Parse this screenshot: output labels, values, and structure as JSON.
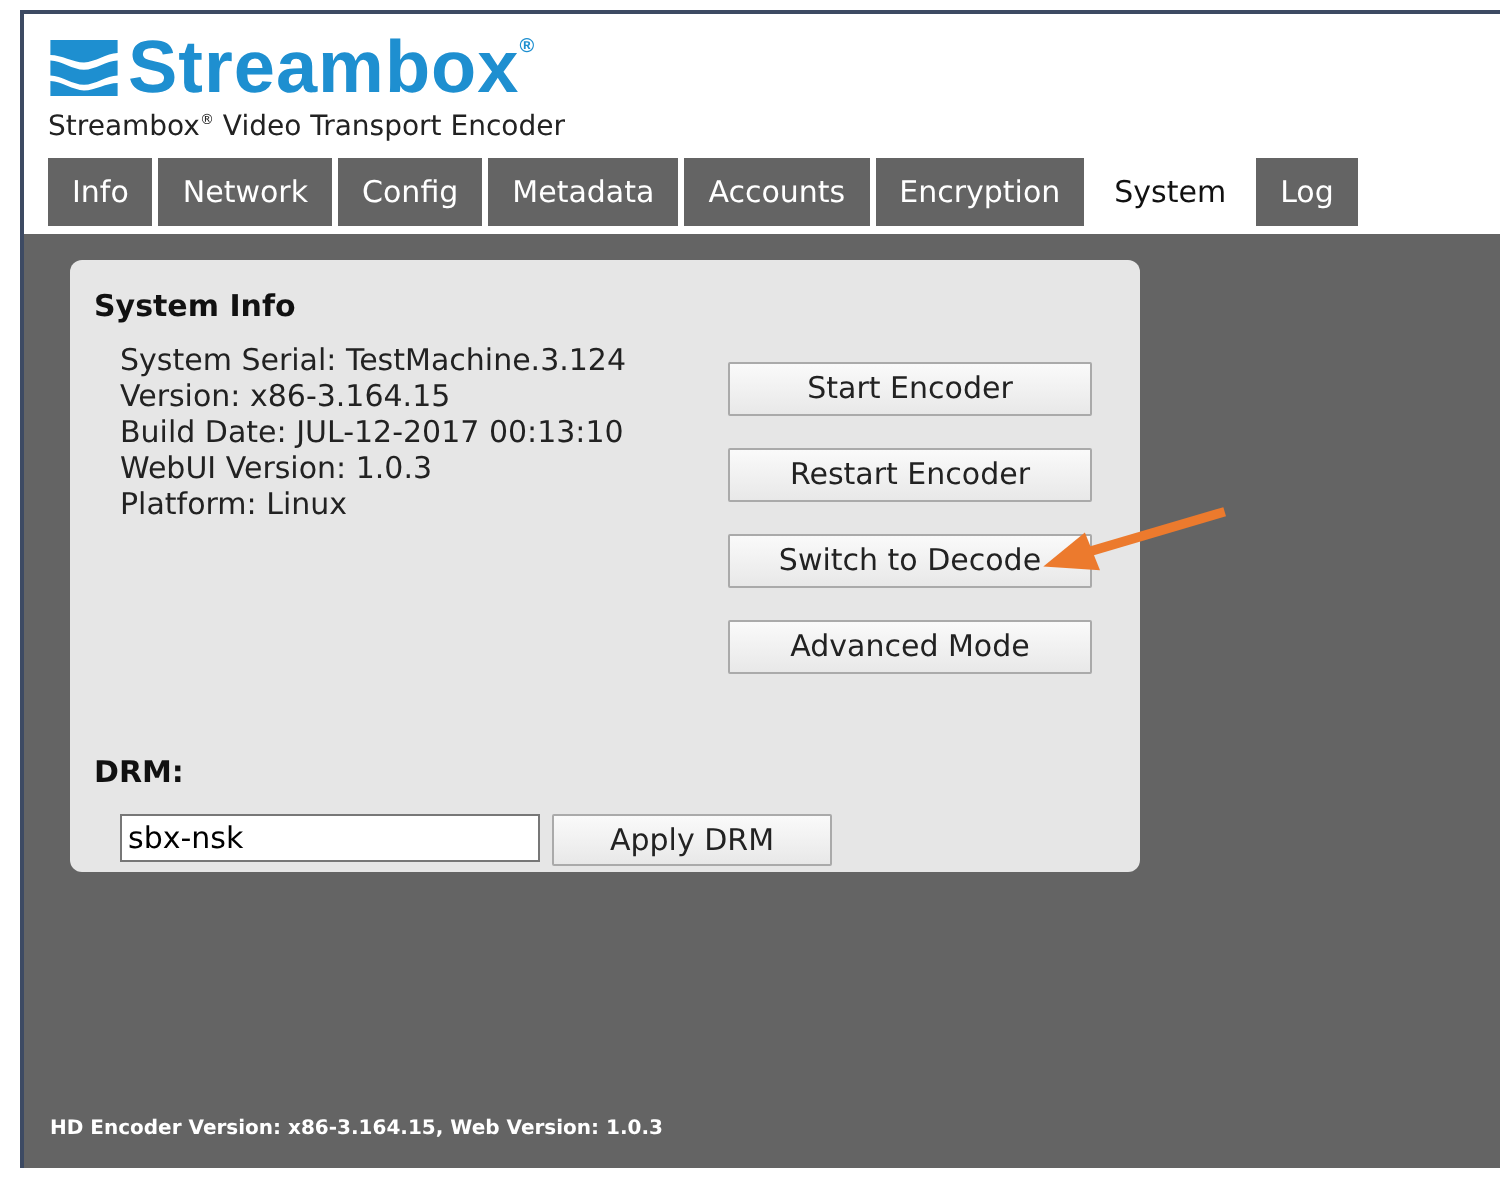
{
  "logo": {
    "name": "Streambox$^{®}$",
    "subtitle": "Streambox$^{®}$ Video Transport Encoder"
  },
  "tabs": [
    {
      "label": "Info",
      "selected": false
    },
    {
      "label": "Network",
      "selected": false
    },
    {
      "label": "Config",
      "selected": false
    },
    {
      "label": "Metadata",
      "selected": false
    },
    {
      "label": "Accounts",
      "selected": false
    },
    {
      "label": "Encryption",
      "selected": false
    },
    {
      "label": "System",
      "selected": true
    },
    {
      "label": "Log",
      "selected": false
    }
  ],
  "system_info": {
    "heading": "System Info",
    "lines": [
      "System Serial: TestMachine.3.124",
      "Version: x86-3.164.15",
      "Build Date: JUL-12-2017 00:13:10",
      "WebUI Version: 1.0.3",
      "Platform: Linux"
    ],
    "buttons": [
      {
        "label": "Start Encoder",
        "kind": "plain"
      },
      {
        "label": "Restart Encoder",
        "kind": "plain"
      },
      {
        "label": "Switch to Decode",
        "kind": "annotated"
      },
      {
        "label": "Advanced Mode",
        "kind": "plain"
      }
    ]
  },
  "drm": {
    "heading": "DRM:",
    "value": "sbx-nsk",
    "button": "Apply DRM"
  },
  "status_bar": "HD Encoder Version: x86-3.164.15, Web Version: 1.0.3"
}
